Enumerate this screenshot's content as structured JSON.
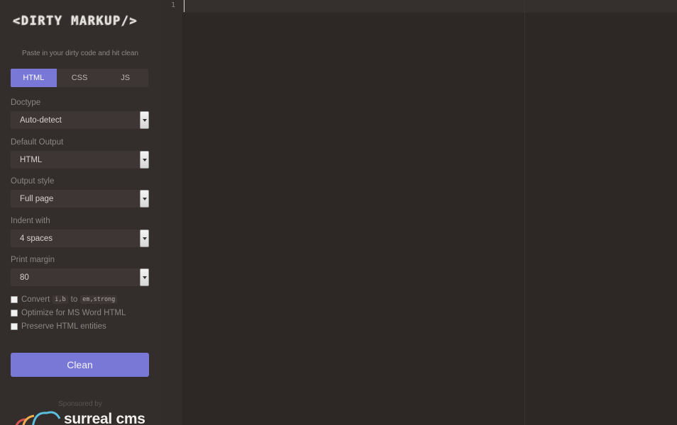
{
  "app": {
    "logo_text": "<DIRTY MARKUP/>",
    "tagline": "Paste in your dirty code and hit clean"
  },
  "tabs": [
    {
      "label": "HTML",
      "active": true
    },
    {
      "label": "CSS",
      "active": false
    },
    {
      "label": "JS",
      "active": false
    }
  ],
  "options": {
    "doctype": {
      "label": "Doctype",
      "value": "Auto-detect"
    },
    "default_output": {
      "label": "Default Output",
      "value": "HTML"
    },
    "output_style": {
      "label": "Output style",
      "value": "Full page"
    },
    "indent_with": {
      "label": "Indent with",
      "value": "4 spaces"
    },
    "print_margin": {
      "label": "Print margin",
      "value": "80"
    }
  },
  "checkboxes": {
    "convert": {
      "prefix": "Convert",
      "code1": "i,b",
      "middle": "to",
      "code2": "em,strong",
      "checked": false
    },
    "optimize": {
      "label": "Optimize for MS Word HTML",
      "checked": false
    },
    "preserve": {
      "label": "Preserve HTML entities",
      "checked": false
    }
  },
  "clean_button": {
    "label": "Clean"
  },
  "sponsor": {
    "label": "Sponsored by",
    "name": "surreal cms"
  },
  "editor": {
    "line_numbers": [
      "1"
    ]
  },
  "colors": {
    "accent": "#7a78d6",
    "sidebar_bg": "#332d2b",
    "editor_bg": "#2d2826"
  }
}
